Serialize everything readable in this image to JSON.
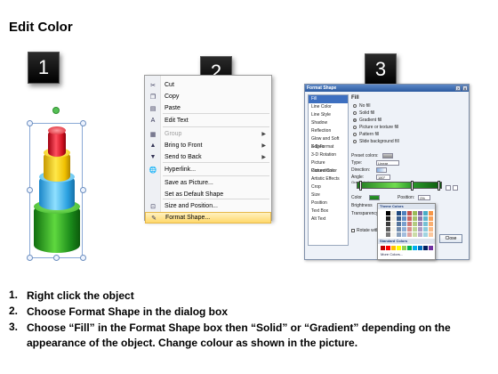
{
  "title": "Edit Color",
  "steps": {
    "badge1": "1",
    "badge2": "2",
    "badge3": "3"
  },
  "context_menu": {
    "items": [
      {
        "label": "Cut",
        "icon": "scissors-icon",
        "disabled": false,
        "submenu": false
      },
      {
        "label": "Copy",
        "icon": "copy-icon",
        "disabled": false,
        "submenu": false
      },
      {
        "label": "Paste",
        "icon": "paste-icon",
        "disabled": false,
        "submenu": false
      },
      {
        "label": "Edit Text",
        "icon": "edit-text-icon",
        "disabled": false,
        "submenu": false
      },
      {
        "label": "Group",
        "icon": "group-icon",
        "disabled": true,
        "submenu": true
      },
      {
        "label": "Bring to Front",
        "icon": "bring-front-icon",
        "disabled": false,
        "submenu": true
      },
      {
        "label": "Send to Back",
        "icon": "send-back-icon",
        "disabled": false,
        "submenu": true
      },
      {
        "label": "Hyperlink...",
        "icon": "hyperlink-icon",
        "disabled": false,
        "submenu": false
      },
      {
        "label": "Save as Picture...",
        "icon": "",
        "disabled": false,
        "submenu": false
      },
      {
        "label": "Set as Default Shape",
        "icon": "",
        "disabled": false,
        "submenu": false
      },
      {
        "label": "Size and Position...",
        "icon": "size-icon",
        "disabled": false,
        "submenu": false
      },
      {
        "label": "Format Shape...",
        "icon": "format-shape-icon",
        "disabled": false,
        "submenu": false,
        "highlighted": true
      }
    ]
  },
  "dialog": {
    "title": "Format Shape",
    "help_btn": "?",
    "close_btn": "X",
    "nav": [
      "Fill",
      "Line Color",
      "Line Style",
      "Shadow",
      "Reflection",
      "Glow and Soft Edges",
      "3-D Format",
      "3-D Rotation",
      "Picture Corrections",
      "Picture Color",
      "Artistic Effects",
      "Crop",
      "Size",
      "Position",
      "Text Box",
      "Alt Text"
    ],
    "section": "Fill",
    "fill_options": [
      "No fill",
      "Solid fill",
      "Gradient fill",
      "Picture or texture fill",
      "Pattern fill",
      "Slide background fill"
    ],
    "selected_fill": "Gradient fill",
    "fields": {
      "preset_colors": "Preset colors:",
      "type": "Type:",
      "type_value": "Linear",
      "direction": "Direction:",
      "angle": "Angle:",
      "angle_value": "180°",
      "gradient_stops": "Gradient stops",
      "color": "Color",
      "position": "Position:",
      "position_value": "0%",
      "brightness": "Brightness",
      "transparency": "Transparency",
      "rotate": "Rotate with shape"
    },
    "popup": {
      "theme_colors": "Theme Colors",
      "standard_colors": "Standard Colors",
      "more_colors": "More Colors..."
    },
    "close_label": "Close",
    "colors": {
      "accent": "#3d6fc0",
      "gradient_dark": "#1f7a1f",
      "gradient_light": "#6fdc4f"
    }
  },
  "instructions": [
    {
      "num": "1.",
      "text": "Right click the object"
    },
    {
      "num": "2.",
      "text": "Choose Format Shape in the dialog box"
    },
    {
      "num": "3.",
      "text": "Choose “Fill” in the Format Shape box then “Solid” or “Gradient” depending on the appearance of the object. Change colour as shown in the picture."
    }
  ]
}
